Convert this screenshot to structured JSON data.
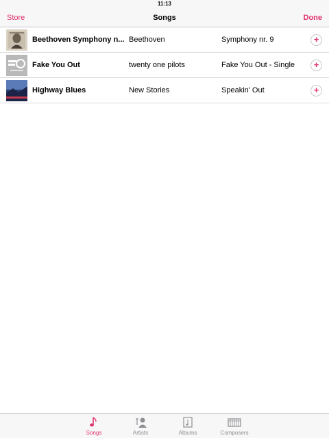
{
  "status": {
    "time": "11:13"
  },
  "nav": {
    "left": "Store",
    "title": "Songs",
    "right": "Done"
  },
  "songs": [
    {
      "title": "Beethoven Symphony n...",
      "artist": "Beethoven",
      "album": "Symphony nr. 9",
      "add": "+"
    },
    {
      "title": "Fake You Out",
      "artist": "twenty one pilots",
      "album": "Fake You Out - Single",
      "add": "+"
    },
    {
      "title": "Highway Blues",
      "artist": "New Stories",
      "album": "Speakin' Out",
      "add": "+"
    }
  ],
  "tabs": [
    {
      "label": "Songs",
      "icon": "music-note-icon"
    },
    {
      "label": "Artists",
      "icon": "artist-icon"
    },
    {
      "label": "Albums",
      "icon": "album-icon"
    },
    {
      "label": "Composers",
      "icon": "piano-keys-icon"
    }
  ],
  "colors": {
    "accent": "#e0336e",
    "inactive": "#8e8e93",
    "bar": "#f7f7f7"
  }
}
